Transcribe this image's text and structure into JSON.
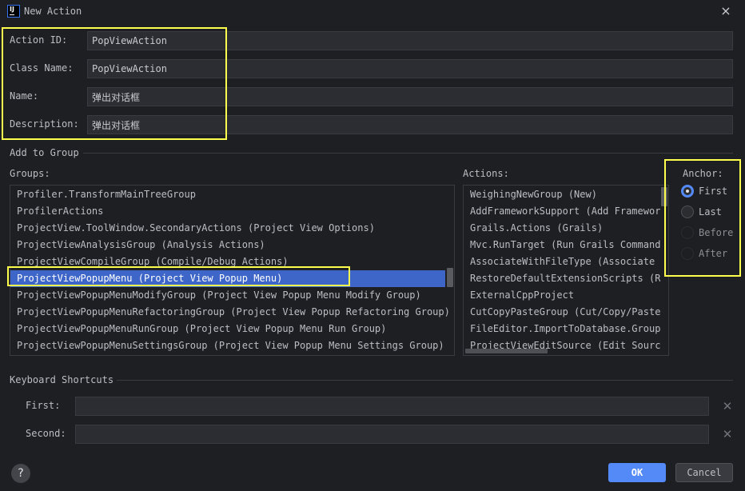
{
  "window": {
    "title": "New Action",
    "logo_text": "IJ"
  },
  "form": {
    "action_id": {
      "label": "Action ID:",
      "value": "PopViewAction"
    },
    "class_name": {
      "label": "Class Name:",
      "value": "PopViewAction"
    },
    "name": {
      "label": "Name:",
      "value": "弹出对话框"
    },
    "description": {
      "label": "Description:",
      "value": "弹出对话框"
    }
  },
  "add_to_group": {
    "section_title": "Add to Group",
    "groups_label": "Groups:",
    "groups": [
      "Profiler.TransformMainTreeGroup",
      "ProfilerActions",
      "ProjectView.ToolWindow.SecondaryActions (Project View Options)",
      "ProjectViewAnalysisGroup (Analysis Actions)",
      "ProjectViewCompileGroup (Compile/Debug Actions)",
      "ProjectViewPopupMenu (Project View Popup Menu)",
      "ProjectViewPopupMenuModifyGroup (Project View Popup Menu Modify Group)",
      "ProjectViewPopupMenuRefactoringGroup (Project View Popup Refactoring Group)",
      "ProjectViewPopupMenuRunGroup (Project View Popup Menu Run Group)",
      "ProjectViewPopupMenuSettingsGroup (Project View Popup Menu Settings Group)"
    ],
    "selected_group_index": 5,
    "actions_label": "Actions:",
    "actions": [
      "WeighingNewGroup (New)",
      "AddFrameworkSupport (Add Framework Support...)",
      "Grails.Actions (Grails)",
      "Mvc.RunTarget (Run Grails Command)",
      "AssociateWithFileType (Associate with File Type...)",
      "RestoreDefaultExtensionScripts (Restore Default Extension Scripts)",
      "ExternalCppProject",
      "CutCopyPasteGroup (Cut/Copy/Paste Actions)",
      "FileEditor.ImportToDatabase.Group",
      "ProjectViewEditSource (Edit Source)"
    ],
    "anchor": {
      "label": "Anchor:",
      "options": [
        {
          "label": "First",
          "checked": true,
          "enabled": true
        },
        {
          "label": "Last",
          "checked": false,
          "enabled": true
        },
        {
          "label": "Before",
          "checked": false,
          "enabled": false
        },
        {
          "label": "After",
          "checked": false,
          "enabled": false
        }
      ]
    }
  },
  "keyboard_shortcuts": {
    "section_title": "Keyboard Shortcuts",
    "first": {
      "label": "First:",
      "value": ""
    },
    "second": {
      "label": "Second:",
      "value": ""
    }
  },
  "footer": {
    "help_label": "?",
    "ok_label": "OK",
    "cancel_label": "Cancel"
  },
  "icons": {
    "close": "×",
    "clear": "✕"
  }
}
